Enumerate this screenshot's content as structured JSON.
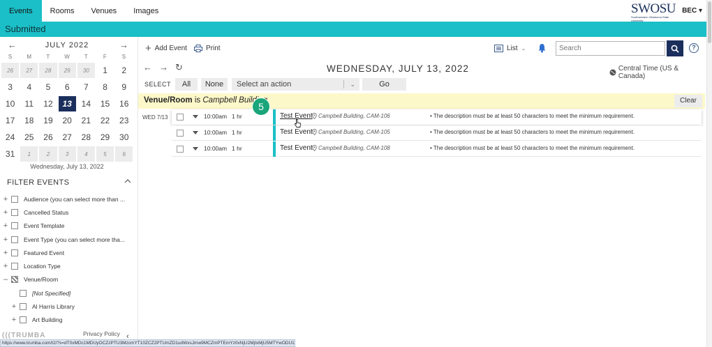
{
  "nav": {
    "tabs": [
      {
        "label": "Events",
        "active": true
      },
      {
        "label": "Rooms"
      },
      {
        "label": "Venues"
      },
      {
        "label": "Images"
      }
    ],
    "brand": "SWOSU",
    "brand_tagline": "Southwestern Oklahoma State University",
    "user": "BEC"
  },
  "status_title": "Submitted",
  "calendar": {
    "month": "JULY 2022",
    "dow": [
      "S",
      "M",
      "T",
      "W",
      "T",
      "F",
      "S"
    ],
    "weeks": [
      [
        {
          "d": "26",
          "o": true
        },
        {
          "d": "27",
          "o": true
        },
        {
          "d": "28",
          "o": true
        },
        {
          "d": "29",
          "o": true
        },
        {
          "d": "30",
          "o": true
        },
        {
          "d": "1"
        },
        {
          "d": "2"
        }
      ],
      [
        {
          "d": "3"
        },
        {
          "d": "4"
        },
        {
          "d": "5"
        },
        {
          "d": "6"
        },
        {
          "d": "7"
        },
        {
          "d": "8"
        },
        {
          "d": "9"
        }
      ],
      [
        {
          "d": "10"
        },
        {
          "d": "11"
        },
        {
          "d": "12"
        },
        {
          "d": "13",
          "s": true
        },
        {
          "d": "14"
        },
        {
          "d": "15"
        },
        {
          "d": "16"
        }
      ],
      [
        {
          "d": "17"
        },
        {
          "d": "18"
        },
        {
          "d": "19"
        },
        {
          "d": "20"
        },
        {
          "d": "21"
        },
        {
          "d": "22"
        },
        {
          "d": "23"
        }
      ],
      [
        {
          "d": "24"
        },
        {
          "d": "25"
        },
        {
          "d": "26"
        },
        {
          "d": "27"
        },
        {
          "d": "28"
        },
        {
          "d": "29"
        },
        {
          "d": "30"
        }
      ],
      [
        {
          "d": "31"
        },
        {
          "d": "1",
          "o": true
        },
        {
          "d": "2",
          "o": true
        },
        {
          "d": "3",
          "o": true
        },
        {
          "d": "4",
          "o": true
        },
        {
          "d": "5",
          "o": true
        },
        {
          "d": "6",
          "o": true
        }
      ]
    ],
    "selected_label": "Wednesday, July 13, 2022"
  },
  "filters": {
    "heading": "FILTER EVENTS",
    "items": [
      {
        "label": "Audience (you can select more than ...",
        "pm": "+"
      },
      {
        "label": "Cancelled Status",
        "pm": "+"
      },
      {
        "label": "Event Template",
        "pm": "+"
      },
      {
        "label": "Event Type (you can select more tha...",
        "pm": "+"
      },
      {
        "label": "Featured Event",
        "pm": "+"
      },
      {
        "label": "Location Type",
        "pm": "+"
      },
      {
        "label": "Venue/Room",
        "pm": "–",
        "mixed": true
      },
      {
        "label": "[Not Specified]",
        "pm": "",
        "sub": true,
        "italic": true
      },
      {
        "label": "Al Harris Library",
        "pm": "+",
        "sub": true
      },
      {
        "label": "Art Building",
        "pm": "+",
        "sub": true
      }
    ]
  },
  "footer": {
    "privacy": "Privacy Policy",
    "trumba": "TRUMBA",
    "url": "https://www.trumba.com/t2/?s=dT0xMDc1MDUyOCZzPTU3MzcmYT10ZCZ2PTUmZD1udWxsJmw9MCZmPTEmYz0xNjU2MjIxMjU5MTYwODU1MDgy"
  },
  "toolbar": {
    "add_event": "Add Event",
    "print": "Print",
    "view": "List",
    "search_placeholder": "Search",
    "help": "?"
  },
  "date_title": "WEDNESDAY, JULY 13, 2022",
  "timezone": "Central Time (US & Canada)",
  "select_row": {
    "label": "SELECT",
    "all": "All",
    "none": "None",
    "action_placeholder": "Select an action",
    "go": "Go"
  },
  "filter_bar": {
    "key": "Venue/Room",
    "is": "is",
    "value": "Campbell Building",
    "clear": "Clear"
  },
  "step_badge": "5",
  "events": {
    "day_label": "WED 7/13",
    "rows": [
      {
        "time": "10:00am",
        "duration": "1 hr",
        "title": "Test Event",
        "location": "Campbell Building, CAM-106",
        "description": "• The description must be at least 50 characters to meet the minimum requirement."
      },
      {
        "time": "10:00am",
        "duration": "1 hr",
        "title": "Test Event",
        "location": "Campbell Building, CAM-105",
        "description": "• The description must be at least 50 characters to meet the minimum requirement."
      },
      {
        "time": "10:00am",
        "duration": "1 hr",
        "title": "Test Event",
        "location": "Campbell Building, CAM-108",
        "description": "• The description must be at least 50 characters to meet the minimum requirement."
      }
    ]
  },
  "colors": {
    "accent": "#1bbfc7",
    "navy": "#1b2f5c",
    "badge": "#1aa57a",
    "filter_bg": "#fdf8c9"
  }
}
